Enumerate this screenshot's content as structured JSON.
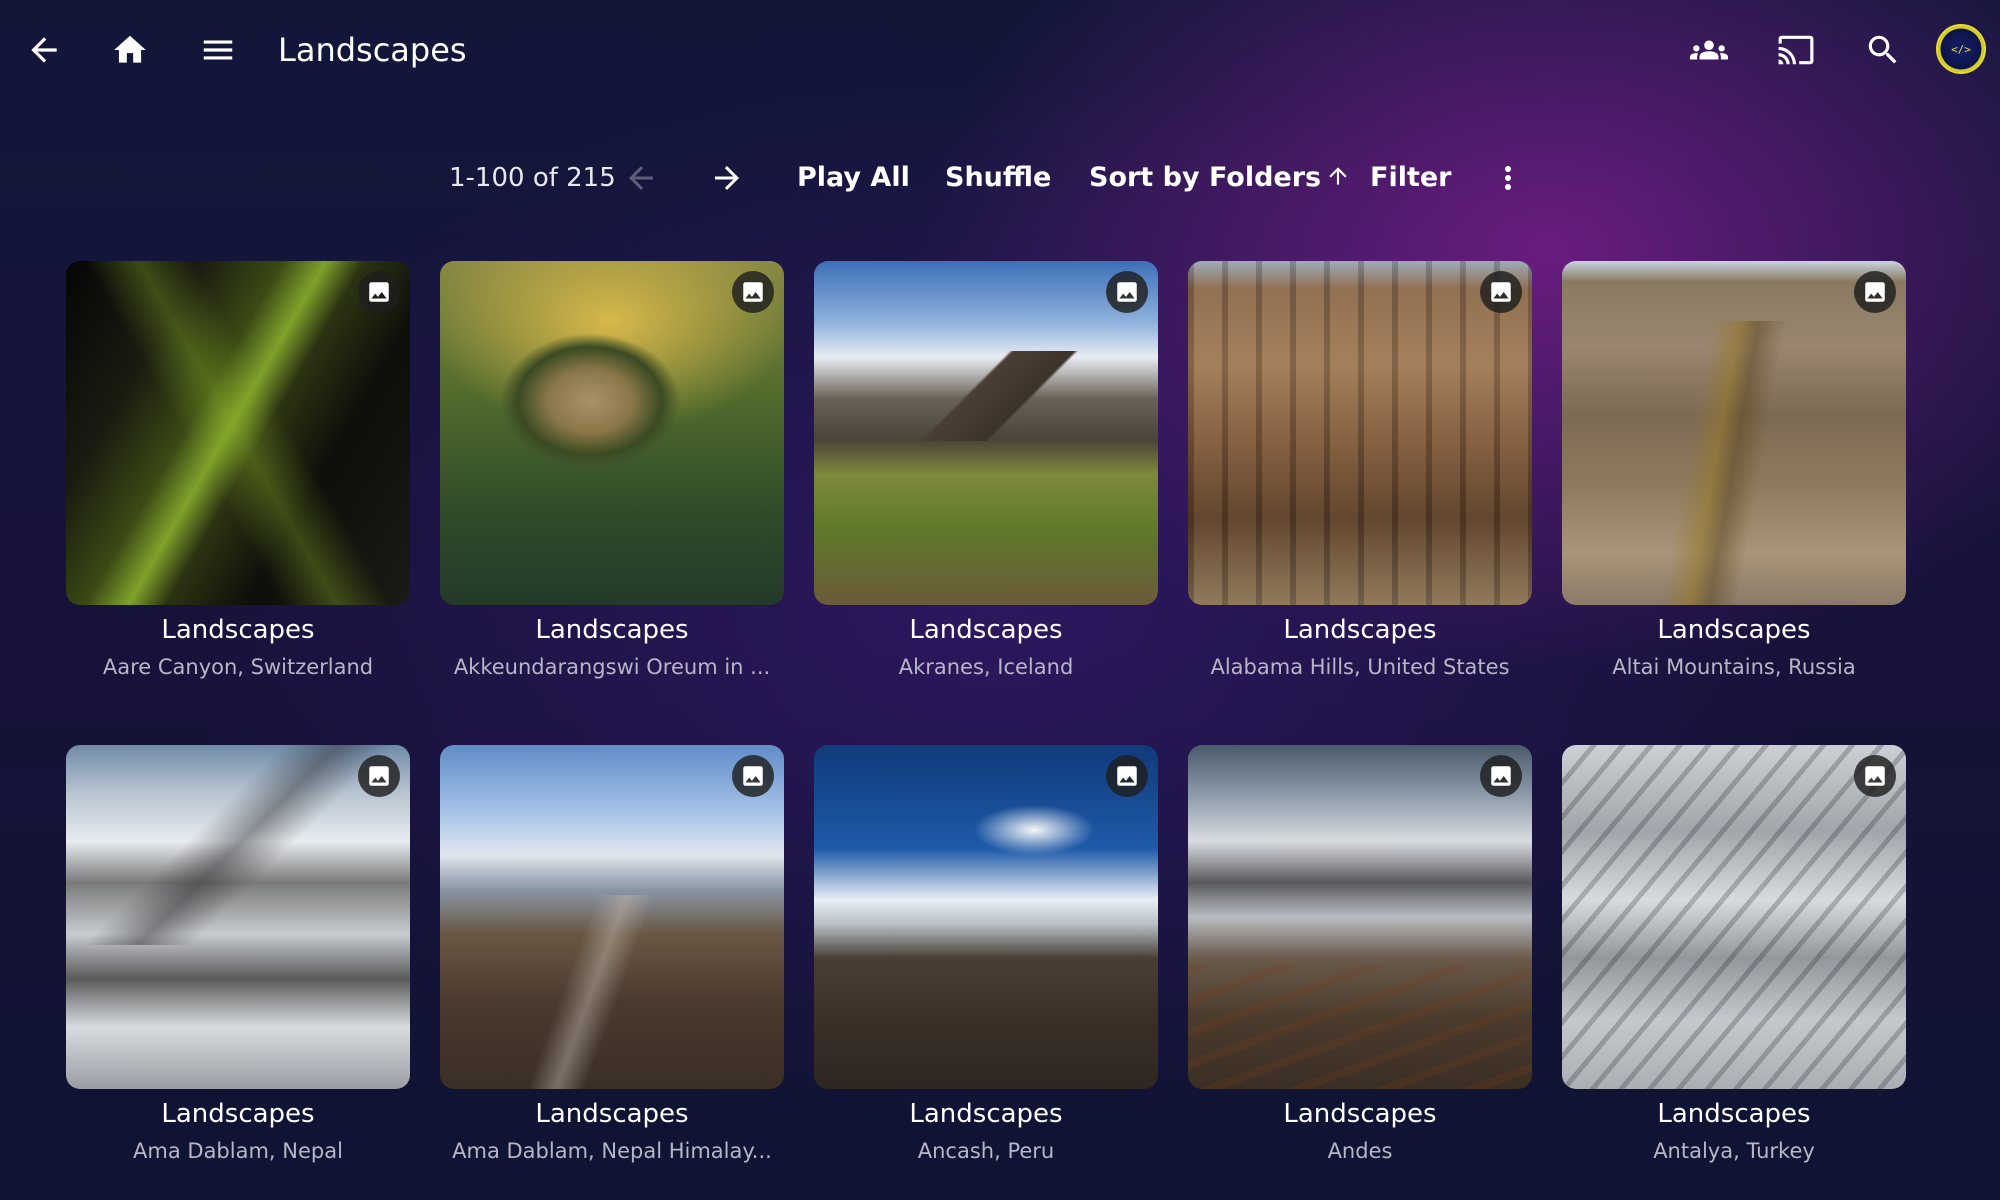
{
  "header": {
    "title": "Landscapes",
    "avatar_text": "</>"
  },
  "toolbar": {
    "pager": "1-100 of 215",
    "play_all": "Play All",
    "shuffle": "Shuffle",
    "sort": "Sort by Folders",
    "filter": "Filter"
  },
  "items": [
    {
      "title": "Landscapes",
      "subtitle": "Aare Canyon, Switzerland"
    },
    {
      "title": "Landscapes",
      "subtitle": "Akkeundarangswi Oreum in ..."
    },
    {
      "title": "Landscapes",
      "subtitle": "Akranes, Iceland"
    },
    {
      "title": "Landscapes",
      "subtitle": "Alabama Hills, United States"
    },
    {
      "title": "Landscapes",
      "subtitle": "Altai Mountains, Russia"
    },
    {
      "title": "Landscapes",
      "subtitle": "Ama Dablam, Nepal"
    },
    {
      "title": "Landscapes",
      "subtitle": "Ama Dablam, Nepal Himalay..."
    },
    {
      "title": "Landscapes",
      "subtitle": "Ancash, Peru"
    },
    {
      "title": "Landscapes",
      "subtitle": "Andes"
    },
    {
      "title": "Landscapes",
      "subtitle": "Antalya, Turkey"
    }
  ]
}
